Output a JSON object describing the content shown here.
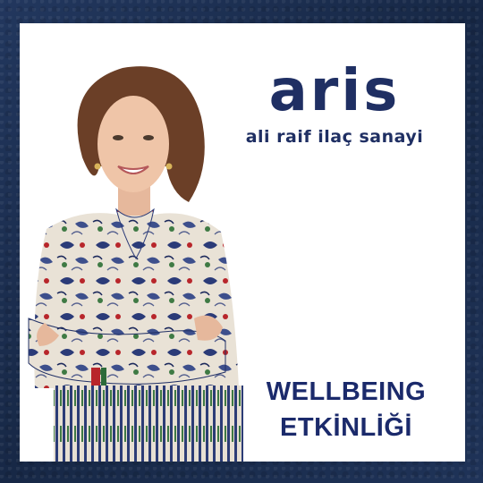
{
  "brand": {
    "name": "aris",
    "subtitle": "ali raif ilaç sanayi",
    "color": "#1f2f63"
  },
  "headline": {
    "line1": "WELLBEING",
    "line2": "ETKİNLİĞİ",
    "color": "#1b2a6b"
  },
  "photo": {
    "description_icon": "woman-portrait-photo"
  },
  "colors": {
    "background": "#1c2f52",
    "card": "#ffffff"
  }
}
